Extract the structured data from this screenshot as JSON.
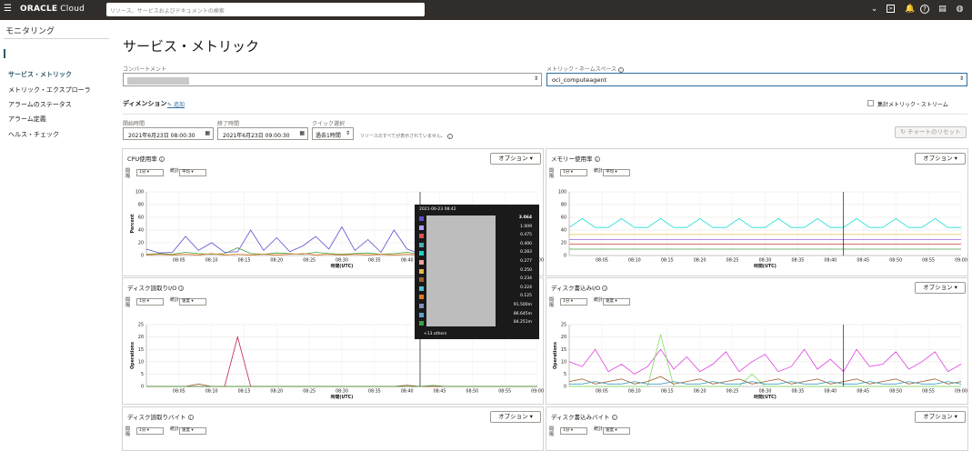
{
  "topbar": {
    "logo_brand": "ORACLE",
    "logo_product": "Cloud",
    "search_placeholder": "リソース、サービスおよびドキュメントの検索"
  },
  "sidebar": {
    "title": "モニタリング",
    "items": [
      {
        "label": "サービス・メトリック",
        "active": true
      },
      {
        "label": "メトリック・エクスプローラ",
        "active": false
      },
      {
        "label": "アラームのステータス",
        "active": false
      },
      {
        "label": "アラーム定義",
        "active": false
      },
      {
        "label": "ヘルス・チェック",
        "active": false
      }
    ]
  },
  "page": {
    "title": "サービス・メトリック",
    "compartment_label": "コンパートメント",
    "namespace_label": "メトリック・ネームスペース",
    "namespace_value": "oci_computeagent",
    "dimension_label": "ディメンション",
    "add_link": "追加",
    "aggregate_label": "集計メトリック・ストリーム",
    "start_label": "開始時間",
    "start_value": "2021年6月23日 08:00:30",
    "end_label": "終了時間",
    "end_value": "2021年6月23日 09:00:30",
    "quick_label": "クイック選択",
    "quick_value": "過去1時間",
    "resource_note": "リソースのすべてが表示されていません。",
    "reset_button": "チャートのリセット"
  },
  "controls": {
    "interval_label": "間隔",
    "stat_label": "統計",
    "interval_value": "1分",
    "stat_mean": "平均",
    "stat_rate": "速度",
    "options_label": "オプション"
  },
  "xticks": [
    "08:05",
    "08:10",
    "08:15",
    "08:20",
    "08:25",
    "08:30",
    "08:35",
    "08:40",
    "08:45",
    "08:50",
    "08:55",
    "09:00"
  ],
  "xlabel": "時間(UTC)",
  "panels": [
    {
      "title": "CPU使用率",
      "stat": "平均",
      "ylabel": "Percent",
      "yticks": [
        "100",
        "80",
        "60",
        "40",
        "20",
        "0"
      ]
    },
    {
      "title": "メモリー使用率",
      "stat": "平均",
      "ylabel": "",
      "yticks": [
        "100",
        "80",
        "60",
        "40",
        "20",
        "0"
      ]
    },
    {
      "title": "ディスク読取りI/O",
      "stat": "速度",
      "ylabel": "Operations",
      "yticks": [
        "25",
        "20",
        "15",
        "10",
        "5",
        "0"
      ]
    },
    {
      "title": "ディスク書込みI/O",
      "stat": "速度",
      "ylabel": "Operations",
      "yticks": [
        "25",
        "20",
        "15",
        "10",
        "5",
        "0"
      ]
    },
    {
      "title": "ディスク読取りバイト",
      "stat": "速度"
    },
    {
      "title": "ディスク書込みバイト",
      "stat": "速度"
    }
  ],
  "tooltip": {
    "timestamp": "2021-06-23 08:42",
    "rows": [
      {
        "color": "#5b4fcf",
        "value": "3.064"
      },
      {
        "color": "#b0a0ff",
        "value": "1.009"
      },
      {
        "color": "#d9534f",
        "value": "0.475"
      },
      {
        "color": "#4ab0b0",
        "value": "0.400"
      },
      {
        "color": "#20d0c8",
        "value": "0.283"
      },
      {
        "color": "#f2a0a0",
        "value": "0.277"
      },
      {
        "color": "#e8b84a",
        "value": "0.250"
      },
      {
        "color": "#a06030",
        "value": "0.234"
      },
      {
        "color": "#50c0d0",
        "value": "0.224"
      },
      {
        "color": "#e87820",
        "value": "0.125"
      },
      {
        "color": "#8090c0",
        "value": "91.500m"
      },
      {
        "color": "#60a0d0",
        "value": "86.645m"
      },
      {
        "color": "#40a040",
        "value": "84.251m"
      }
    ],
    "others": "+13 others"
  },
  "chart_data": [
    {
      "type": "line",
      "title": "CPU使用率",
      "ylabel": "Percent",
      "xlabel": "時間(UTC)",
      "ylim": [
        0,
        100
      ],
      "x": [
        "08:00",
        "08:02",
        "08:04",
        "08:06",
        "08:08",
        "08:10",
        "08:12",
        "08:14",
        "08:16",
        "08:18",
        "08:20",
        "08:22",
        "08:24",
        "08:26",
        "08:28",
        "08:30",
        "08:32",
        "08:34",
        "08:36",
        "08:38",
        "08:40",
        "08:42"
      ],
      "series": [
        {
          "color": "#5b4fcf",
          "values": [
            10,
            4,
            5,
            30,
            8,
            20,
            5,
            6,
            40,
            8,
            28,
            6,
            15,
            30,
            10,
            45,
            8,
            25,
            5,
            40,
            10,
            3
          ]
        },
        {
          "color": "#40a040",
          "values": [
            2,
            3,
            2,
            5,
            3,
            2,
            3,
            12,
            3,
            2,
            4,
            3,
            2,
            5,
            3,
            2,
            3,
            4,
            2,
            3,
            5,
            2
          ]
        },
        {
          "color": "#e87820",
          "values": [
            1,
            2,
            1,
            2,
            1,
            3,
            1,
            2,
            1,
            2,
            1,
            2,
            3,
            1,
            2,
            1,
            2,
            1,
            2,
            1,
            2,
            1
          ]
        }
      ]
    },
    {
      "type": "line",
      "title": "メモリー使用率",
      "xlabel": "時間(UTC)",
      "ylim": [
        0,
        100
      ],
      "x": [
        "08:00",
        "08:02",
        "08:04",
        "08:06",
        "08:08",
        "08:10",
        "08:12",
        "08:14",
        "08:16",
        "08:18",
        "08:20",
        "08:22",
        "08:24",
        "08:26",
        "08:28",
        "08:30",
        "08:32",
        "08:34",
        "08:36",
        "08:38",
        "08:40",
        "08:42",
        "08:44",
        "08:46",
        "08:48",
        "08:50",
        "08:52",
        "08:54",
        "08:56",
        "08:58",
        "09:00"
      ],
      "series": [
        {
          "color": "#20e0d0",
          "values": [
            44,
            58,
            44,
            44,
            58,
            44,
            44,
            58,
            44,
            44,
            58,
            44,
            44,
            58,
            44,
            44,
            58,
            44,
            44,
            58,
            44,
            44,
            58,
            44,
            44,
            58,
            44,
            44,
            58,
            44,
            44
          ]
        },
        {
          "color": "#e8c040",
          "values": [
            33,
            33,
            33,
            33,
            33,
            33,
            33,
            33,
            33,
            33,
            33,
            33,
            33,
            33,
            33,
            33,
            33,
            33,
            33,
            33,
            33,
            33,
            33,
            33,
            33,
            33,
            33,
            33,
            33,
            33,
            33
          ]
        },
        {
          "color": "#a060e0",
          "values": [
            25,
            25,
            25,
            25,
            25,
            25,
            25,
            25,
            25,
            25,
            25,
            25,
            25,
            25,
            25,
            25,
            25,
            25,
            25,
            25,
            25,
            25,
            25,
            25,
            25,
            25,
            25,
            25,
            25,
            25,
            25
          ]
        },
        {
          "color": "#d04040",
          "values": [
            18,
            18,
            18,
            18,
            18,
            18,
            18,
            18,
            18,
            18,
            18,
            18,
            18,
            18,
            18,
            18,
            18,
            18,
            18,
            18,
            18,
            18,
            18,
            18,
            18,
            18,
            18,
            18,
            18,
            18,
            18
          ]
        },
        {
          "color": "#40a040",
          "values": [
            10,
            10,
            10,
            10,
            10,
            10,
            10,
            10,
            10,
            10,
            10,
            10,
            10,
            10,
            10,
            10,
            10,
            10,
            10,
            10,
            10,
            10,
            10,
            10,
            10,
            10,
            10,
            10,
            10,
            10,
            10
          ]
        }
      ]
    },
    {
      "type": "line",
      "title": "ディスク読取りI/O",
      "ylabel": "Operations",
      "xlabel": "時間(UTC)",
      "ylim": [
        0,
        25
      ],
      "x": [
        "08:00",
        "08:02",
        "08:04",
        "08:06",
        "08:08",
        "08:10",
        "08:12",
        "08:14",
        "08:16",
        "08:18",
        "08:20",
        "08:22",
        "08:24",
        "08:26",
        "08:28",
        "08:30",
        "08:32",
        "08:34",
        "08:36",
        "08:38",
        "08:40",
        "08:42",
        "08:44",
        "08:46",
        "08:48",
        "08:50",
        "08:52",
        "08:54",
        "08:56",
        "08:58",
        "09:00"
      ],
      "series": [
        {
          "color": "#c0204a",
          "values": [
            0,
            0,
            0,
            0,
            0,
            0,
            0,
            20,
            0,
            0,
            0,
            0,
            0,
            0,
            0,
            0,
            0,
            0,
            0,
            0,
            0,
            0,
            0,
            0,
            0,
            0,
            0,
            0,
            0,
            0,
            0
          ]
        },
        {
          "color": "#a06030",
          "values": [
            0,
            0,
            0,
            0,
            1,
            0,
            0,
            0,
            0,
            0,
            0,
            0,
            0,
            0,
            0,
            0,
            0,
            0,
            0,
            0,
            0.5,
            0,
            0,
            0,
            0,
            0,
            0,
            0,
            0,
            0,
            0
          ]
        },
        {
          "color": "#40a040",
          "values": [
            0,
            0,
            0,
            0,
            0,
            0,
            0,
            0,
            0,
            0,
            0,
            0,
            0,
            0,
            0,
            0,
            0,
            0,
            0,
            0,
            0,
            0,
            0.4,
            0,
            0,
            0,
            0,
            0,
            0,
            0,
            0
          ]
        }
      ]
    },
    {
      "type": "line",
      "title": "ディスク書込みI/O",
      "ylabel": "Operations",
      "xlabel": "時間(UTC)",
      "ylim": [
        0,
        25
      ],
      "x": [
        "08:00",
        "08:02",
        "08:04",
        "08:06",
        "08:08",
        "08:10",
        "08:12",
        "08:14",
        "08:16",
        "08:18",
        "08:20",
        "08:22",
        "08:24",
        "08:26",
        "08:28",
        "08:30",
        "08:32",
        "08:34",
        "08:36",
        "08:38",
        "08:40",
        "08:42",
        "08:44",
        "08:46",
        "08:48",
        "08:50",
        "08:52",
        "08:54",
        "08:56",
        "08:58",
        "09:00"
      ],
      "series": [
        {
          "color": "#e040e0",
          "values": [
            10,
            8,
            15,
            6,
            9,
            5,
            8,
            15,
            7,
            12,
            6,
            9,
            14,
            6,
            10,
            13,
            6,
            8,
            15,
            7,
            11,
            6,
            15,
            8,
            9,
            14,
            7,
            10,
            14,
            6,
            9
          ]
        },
        {
          "color": "#80e060",
          "values": [
            0,
            0,
            0,
            0,
            0,
            0,
            0,
            21,
            0,
            0,
            0,
            0,
            0,
            0,
            5,
            0,
            0,
            0,
            0,
            0,
            0,
            0,
            0,
            0,
            0,
            0,
            0,
            0,
            0,
            0,
            0
          ]
        },
        {
          "color": "#a06030",
          "values": [
            2,
            3,
            1,
            2,
            3,
            1,
            2,
            4,
            1,
            2,
            3,
            1,
            2,
            3,
            1,
            2,
            3,
            1,
            2,
            3,
            1,
            2,
            3,
            1,
            2,
            3,
            1,
            2,
            3,
            1,
            2
          ]
        },
        {
          "color": "#40a0c0",
          "values": [
            1,
            1,
            2,
            1,
            1,
            2,
            1,
            1,
            2,
            1,
            1,
            2,
            1,
            1,
            2,
            1,
            1,
            2,
            1,
            1,
            2,
            1,
            1,
            2,
            1,
            1,
            2,
            1,
            1,
            2,
            1
          ]
        }
      ]
    }
  ]
}
